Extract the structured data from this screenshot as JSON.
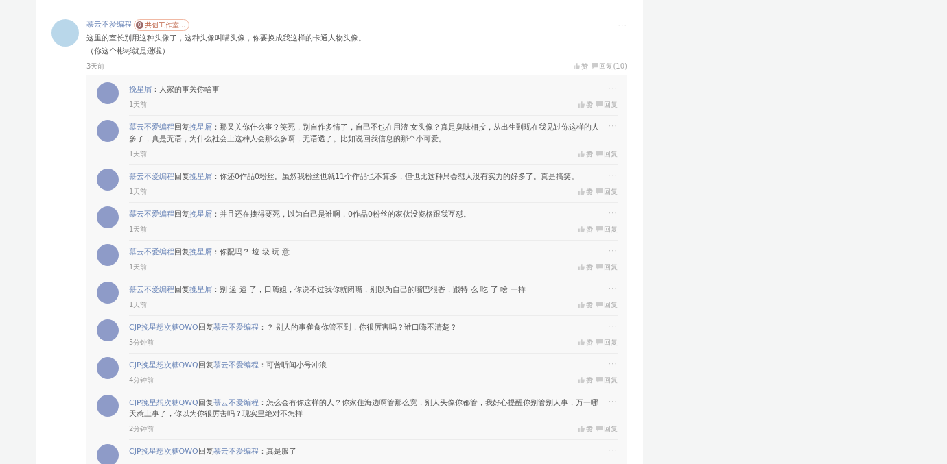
{
  "comment": {
    "author": "慕云不爱编程",
    "badge": {
      "level": "0",
      "label": "共创工作室..."
    },
    "more": "···",
    "text_lines": [
      "这里的室长别用这种头像了，这种头像叫喵头像，你要换成我这样的卡通人物头像。",
      "（你这个彬彬就是逊啦）"
    ],
    "time": "3天前",
    "like": "赞",
    "reply": "回复(10)"
  },
  "replies": [
    {
      "author": "挽星屑",
      "text": "：人家的事关你啥事",
      "more": "···",
      "time": "1天前",
      "like": "赞",
      "reply": "回复"
    },
    {
      "author": "慕云不爱编程",
      "reply_word": "回复",
      "reply_to": "挽星屑",
      "text": "：那又关你什么事？笑死，别自作多情了，自己不也在用渣 女头像？真是臭味相投，从出生到现在我见过你这样的人多了，真是无语，为什么社会上这种人会那么多啊，无语透了。比如说回我信息的那个小可爱。",
      "more": "···",
      "time": "1天前",
      "like": "赞",
      "reply": "回复"
    },
    {
      "author": "慕云不爱编程",
      "reply_word": "回复",
      "reply_to": "挽星屑",
      "text": "：你还0作品0粉丝。虽然我粉丝也就11个作品也不算多，但也比这种只会怼人没有实力的好多了。真是搞笑。",
      "more": "···",
      "time": "1天前",
      "like": "赞",
      "reply": "回复"
    },
    {
      "author": "慕云不爱编程",
      "reply_word": "回复",
      "reply_to": "挽星屑",
      "text": "：并且还在拽得要死，以为自己是谁啊，0作品0粉丝的家伙没资格跟我互怼。",
      "more": "···",
      "time": "1天前",
      "like": "赞",
      "reply": "回复"
    },
    {
      "author": "慕云不爱编程",
      "reply_word": "回复",
      "reply_to": "挽星屑",
      "text": "：你配吗？ 垃 圾 玩 意",
      "more": "···",
      "time": "1天前",
      "like": "赞",
      "reply": "回复"
    },
    {
      "author": "慕云不爱编程",
      "reply_word": "回复",
      "reply_to": "挽星屑",
      "text": "：别 逼 逼 了，口嗨姐，你说不过我你就闭嘴，别以为自己的嘴巴很香，跟特 么 吃 了 啥 一样",
      "more": "···",
      "time": "1天前",
      "like": "赞",
      "reply": "回复"
    },
    {
      "author": "CJP挽星想次糖QWQ",
      "reply_word": "回复",
      "reply_to": "慕云不爱编程",
      "text": "：？ 别人的事雀食你管不到，你很厉害吗？谁口嗨不清楚？",
      "more": "···",
      "time": "5分钟前",
      "like": "赞",
      "reply": "回复"
    },
    {
      "author": "CJP挽星想次糖QWQ",
      "reply_word": "回复",
      "reply_to": "慕云不爱编程",
      "text": "：可曾听闻小号冲浪",
      "more": "···",
      "time": "4分钟前",
      "like": "赞",
      "reply": "回复"
    },
    {
      "author": "CJP挽星想次糖QWQ",
      "reply_word": "回复",
      "reply_to": "慕云不爱编程",
      "text": "：怎么会有你这样的人？你家住海边啊管那么宽，别人头像你都管，我好心提醒你别管别人事，万一哪天惹上事了，你以为你很厉害吗？现实里绝对不怎样",
      "more": "···",
      "time": "2分钟前",
      "like": "赞",
      "reply": "回复"
    },
    {
      "author": "CJP挽星想次糖QWQ",
      "reply_word": "回复",
      "reply_to": "慕云不爱编程",
      "text": "：真是服了",
      "more": "···"
    }
  ]
}
